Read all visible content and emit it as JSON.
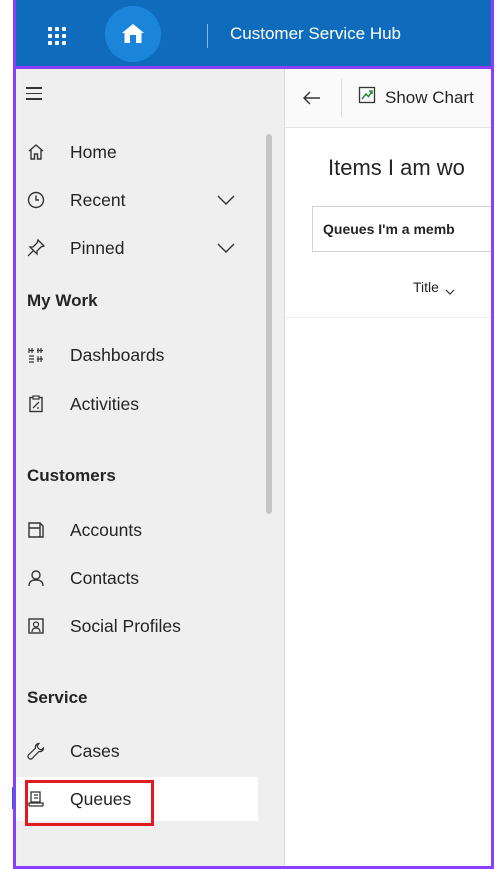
{
  "app": {
    "title": "Customer Service Hub"
  },
  "topbar": {
    "waffle_icon": "app-launcher-icon",
    "home_icon": "home-icon",
    "colors": {
      "background": "#0f6cbd",
      "home_badge": "#1b86d9"
    }
  },
  "sidebar": {
    "items": [
      {
        "label": "Home",
        "icon": "home-outline-icon"
      },
      {
        "label": "Recent",
        "icon": "clock-icon",
        "expandable": true
      },
      {
        "label": "Pinned",
        "icon": "pin-icon",
        "expandable": true
      }
    ],
    "sections": [
      {
        "title": "My Work",
        "items": [
          {
            "label": "Dashboards",
            "icon": "dashboard-icon"
          },
          {
            "label": "Activities",
            "icon": "clipboard-icon"
          }
        ]
      },
      {
        "title": "Customers",
        "items": [
          {
            "label": "Accounts",
            "icon": "building-icon"
          },
          {
            "label": "Contacts",
            "icon": "person-icon"
          },
          {
            "label": "Social Profiles",
            "icon": "social-profile-icon"
          }
        ]
      },
      {
        "title": "Service",
        "items": [
          {
            "label": "Cases",
            "icon": "wrench-icon"
          },
          {
            "label": "Queues",
            "icon": "queue-icon",
            "selected": true
          }
        ]
      }
    ]
  },
  "commandbar": {
    "show_chart_label": "Show Chart"
  },
  "view": {
    "title": "Items I am wo",
    "selector_value": "Queues I'm a memb",
    "columns": [
      {
        "label": "Title"
      }
    ]
  },
  "annotation": {
    "highlight_color": "#e11b22",
    "frame_color": "#8a3ffc"
  }
}
